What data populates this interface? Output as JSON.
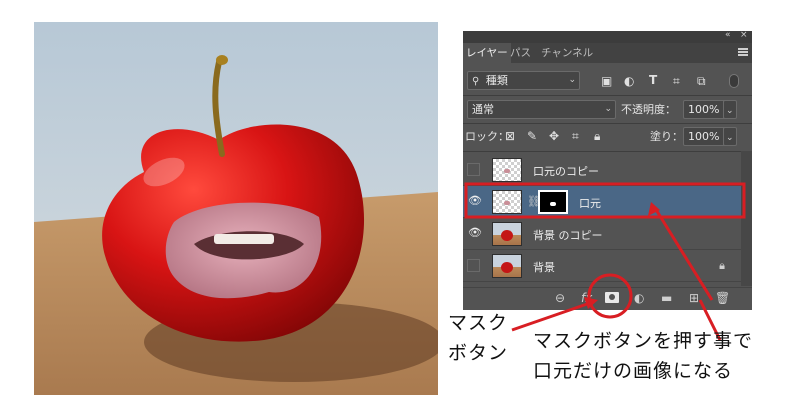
{
  "photo": {
    "alt_subject": "apple-with-mouth"
  },
  "panel": {
    "window_controls": {
      "collapse": "«",
      "close": "×"
    },
    "tabs": [
      {
        "label": "レイヤー",
        "active": true
      },
      {
        "label": "パス",
        "active": false
      },
      {
        "label": "チャンネル",
        "active": false
      }
    ],
    "filter": {
      "icon": "search-icon",
      "value": "種類"
    },
    "blend": {
      "value": "通常"
    },
    "opacity": {
      "label": "不透明度：",
      "value": "100%"
    },
    "lock": {
      "label": "ロック："
    },
    "fill": {
      "label": "塗り：",
      "value": "100%"
    },
    "layers": [
      {
        "name": "口元のコピー",
        "visible": false,
        "selected": false,
        "has_mask": false,
        "thumb": "transparent"
      },
      {
        "name": "口元",
        "visible": true,
        "selected": true,
        "has_mask": true,
        "thumb": "transparent"
      },
      {
        "name": "背景 のコピー",
        "visible": true,
        "selected": false,
        "has_mask": false,
        "thumb": "apple"
      },
      {
        "name": "背景",
        "visible": false,
        "selected": false,
        "has_mask": false,
        "thumb": "apple",
        "locked": true
      }
    ]
  },
  "annotations": {
    "mask_button_label_line1": "マスク",
    "mask_button_label_line2": "ボタン",
    "explanation_line1": "マスクボタンを押す事で",
    "explanation_line2": "口元だけの画像になる",
    "highlight_color": "#d81e23"
  }
}
